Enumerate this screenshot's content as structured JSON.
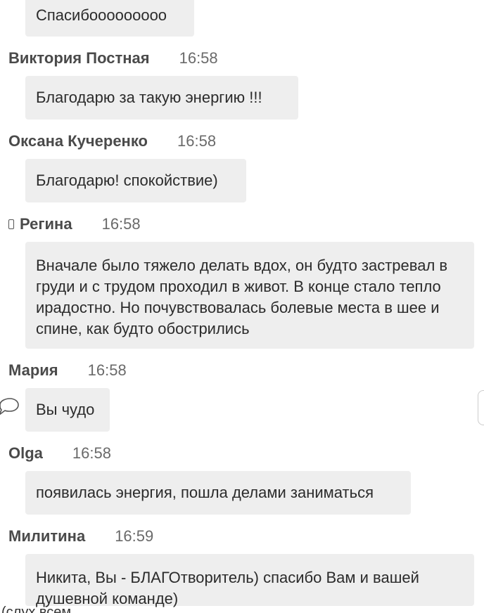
{
  "messages": [
    {
      "author": "",
      "time": "",
      "text": "Спасибооооооооо"
    },
    {
      "author": "Виктория Постная",
      "time": "16:58",
      "text": "Благодарю за такую энергию !!!"
    },
    {
      "author": "Оксана Кучеренко",
      "time": "16:58",
      "text": "Благодарю! спокойствие)"
    },
    {
      "author": "Регина",
      "time": "16:58",
      "text": "Вначале было тяжело делать вдох, он будто застревал в груди и с трудом проходил в живот. В конце стало тепло ирадостно. Но почувствовалась болевые места в шее и спине, как будто обострились",
      "device_icon": "phone-icon"
    },
    {
      "author": "Мария",
      "time": "16:58",
      "text": "Вы чудо",
      "reply_icon": "speech-bubble-icon"
    },
    {
      "author": "Olga",
      "time": "16:58",
      "text": "появилась энергия, пошла делами заниматься"
    },
    {
      "author": "Милитина",
      "time": "16:59",
      "text": "Никита, Вы - БЛАГОтворитель) спасибо Вам и вашей душевной команде)"
    }
  ],
  "footer": {
    "text": "(слух всем"
  }
}
